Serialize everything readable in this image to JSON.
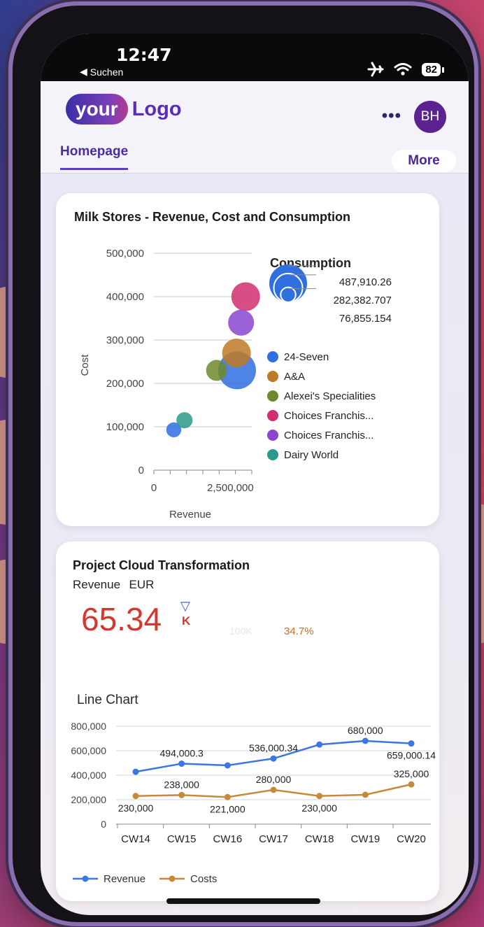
{
  "status_bar": {
    "time": "12:47",
    "back_label": "Suchen",
    "battery": "82"
  },
  "header": {
    "logo_primary": "your",
    "logo_secondary": "Logo",
    "more_dots": "•••",
    "avatar_initials": "BH",
    "tab_label": "Homepage",
    "more_button": "More"
  },
  "card1": {
    "title": "Milk Stores - Revenue, Cost and Consumption",
    "chart_data": {
      "type": "scatter",
      "title": "Milk Stores - Revenue, Cost and Consumption",
      "xlabel": "Revenue",
      "ylabel": "Cost",
      "x_ticks": [
        "0",
        "2,500,000"
      ],
      "y_ticks": [
        "500,000",
        "400,000",
        "300,000",
        "200,000",
        "100,000",
        "0"
      ],
      "xlim": [
        0,
        3200000
      ],
      "ylim": [
        0,
        500000
      ],
      "size_legend_title": "Consumption",
      "size_legend_values": [
        "487,910.26",
        "282,382.707",
        "76,855.154"
      ],
      "series": [
        {
          "name": "24-Seven",
          "color": "#2f6fe0",
          "points": [
            {
              "x": 2720000,
              "y": 230000,
              "size": 487910
            },
            {
              "x": 650000,
              "y": 93000,
              "size": 76855
            }
          ]
        },
        {
          "name": "A&A",
          "color": "#c07a26",
          "points": [
            {
              "x": 2700000,
              "y": 270000,
              "size": 282382
            }
          ]
        },
        {
          "name": "Alexei's Specialities",
          "color": "#6f8a2c",
          "points": [
            {
              "x": 2050000,
              "y": 230000,
              "size": 150000
            }
          ]
        },
        {
          "name": "Choices Franchis...",
          "color": "#d12f6e",
          "points": [
            {
              "x": 3000000,
              "y": 400000,
              "size": 282382
            }
          ]
        },
        {
          "name": "Choices Franchis...",
          "color": "#8a46d0",
          "points": [
            {
              "x": 2850000,
              "y": 340000,
              "size": 230000
            }
          ]
        },
        {
          "name": "Dairy World",
          "color": "#2a9a8a",
          "points": [
            {
              "x": 1000000,
              "y": 115000,
              "size": 90000
            }
          ]
        }
      ],
      "legend_position": "right"
    }
  },
  "card2": {
    "title": "Project Cloud Transformation",
    "kpi_label": "Revenue",
    "kpi_unit": "EUR",
    "kpi_value": "65.34",
    "kpi_scale": "K",
    "kpi_target": "100K",
    "kpi_deviation": "34.7%",
    "line_title": "Line Chart",
    "chart_data": {
      "type": "line",
      "categories": [
        "CW14",
        "CW15",
        "CW16",
        "CW17",
        "CW18",
        "CW19",
        "CW20"
      ],
      "ylim": [
        0,
        800000
      ],
      "y_ticks": [
        "800,000",
        "600,000",
        "400,000",
        "200,000",
        "0"
      ],
      "series": [
        {
          "name": "Revenue",
          "color": "#3a78e0",
          "values": [
            428000,
            494000.3,
            480000,
            536000.34,
            650000,
            680000,
            659000.14
          ],
          "labels": [
            "",
            "494,000.3",
            "",
            "536,000.34",
            "",
            "680,000",
            "659,000.14"
          ]
        },
        {
          "name": "Costs",
          "color": "#c58a3a",
          "values": [
            230000,
            238000,
            221000,
            280000,
            230000,
            240000,
            325000
          ],
          "labels": [
            "230,000",
            "238,000",
            "221,000",
            "280,000",
            "230,000",
            "",
            "325,000"
          ]
        }
      ],
      "legend_position": "bottom-left"
    }
  }
}
